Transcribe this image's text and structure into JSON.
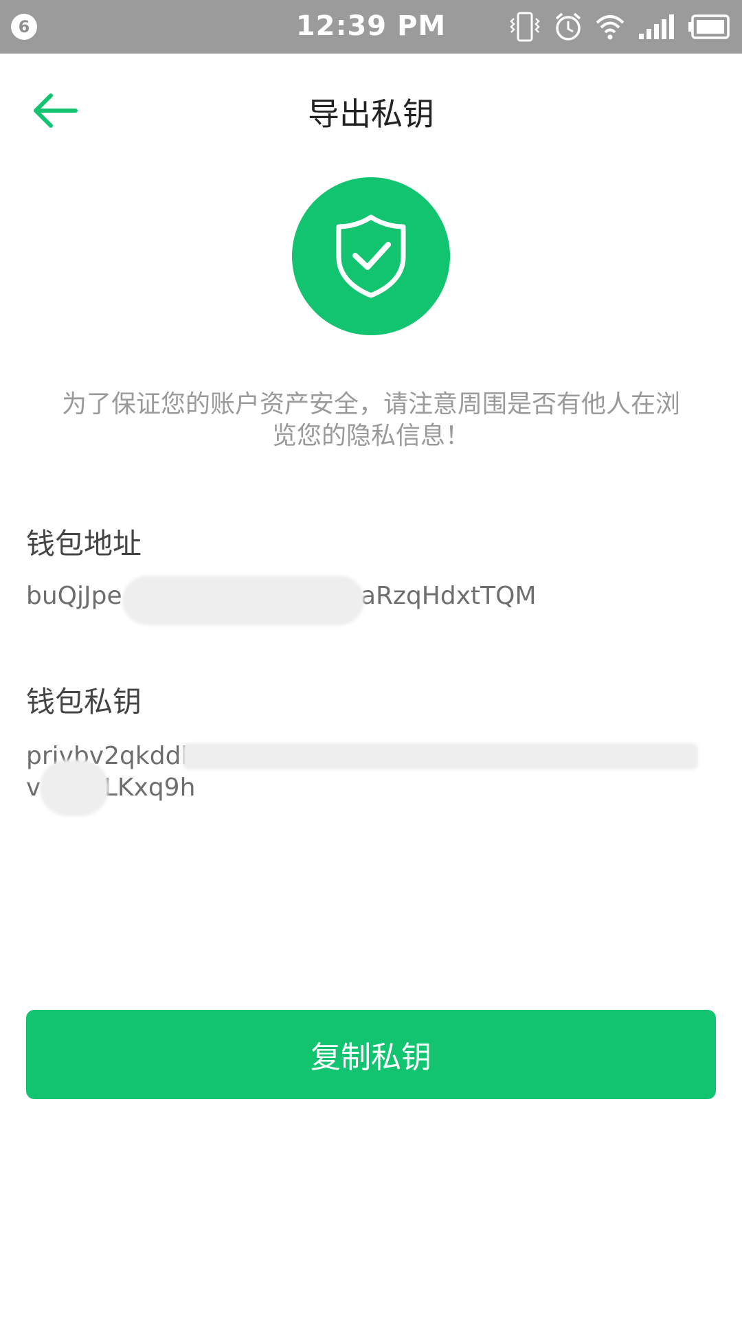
{
  "status_bar": {
    "notification_count": "6",
    "time": "12:39 PM"
  },
  "header": {
    "title": "导出私钥"
  },
  "warning": {
    "text": "为了保证您的账户资产安全，请注意周围是否有他人在浏览您的隐私信息！"
  },
  "wallet_address": {
    "label": "钱包地址",
    "value": "buQjJpe                          N9aRzqHdxtTQM"
  },
  "private_key": {
    "label": "钱包私钥",
    "line1": "privbv2qkddb",
    "line2": "v        LKxq9h"
  },
  "copy_button": {
    "label": "复制私钥"
  },
  "colors": {
    "accent": "#12c46f",
    "status_bar": "#9b9b9b"
  },
  "icons": {
    "back": "arrow-left-icon",
    "shield": "shield-check-icon"
  }
}
